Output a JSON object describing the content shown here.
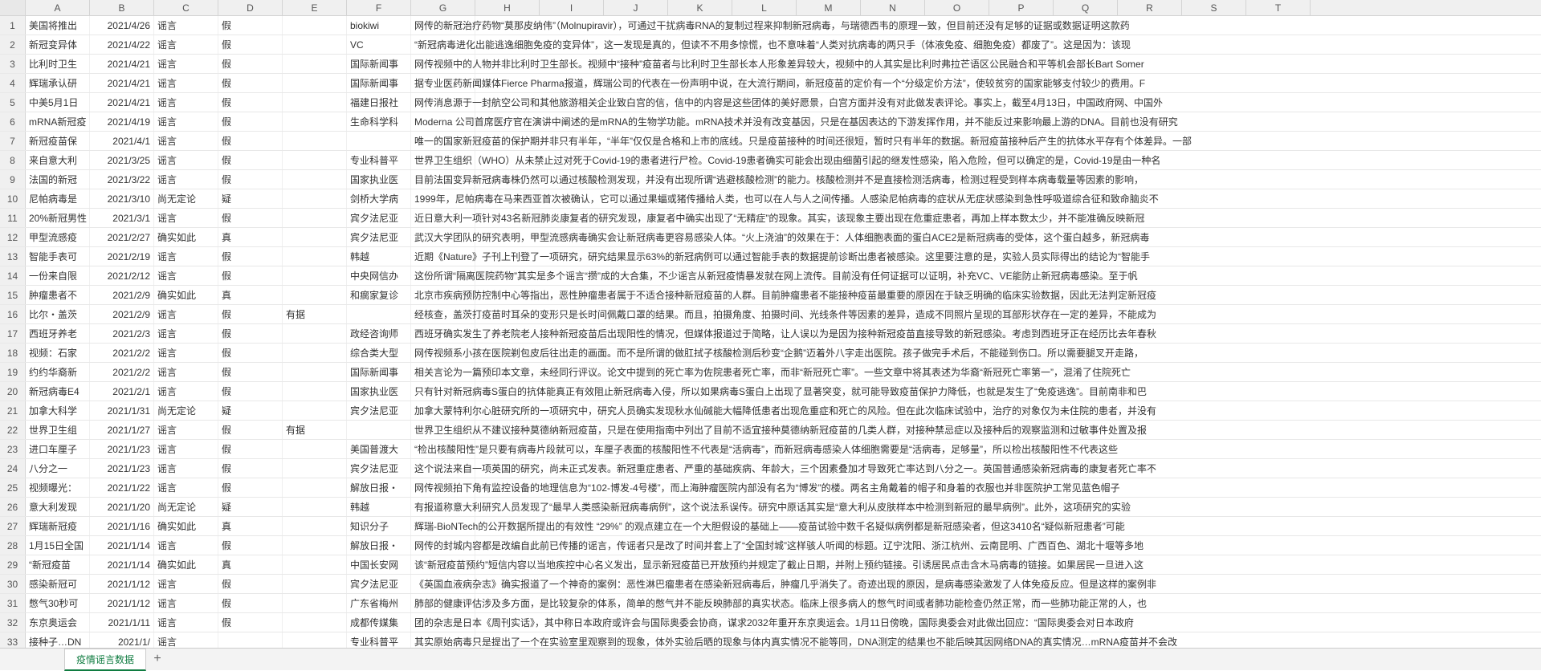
{
  "sheetTab": "疫情谣言数据",
  "colWidths": {
    "A": 80,
    "B": 80,
    "C": 80,
    "D": 80,
    "E": 80,
    "F": 80,
    "G": 80,
    "H": 80,
    "I": 80,
    "J": 80,
    "K": 80,
    "L": 80,
    "M": 80,
    "N": 80,
    "O": 80,
    "P": 80,
    "Q": 80,
    "R": 80,
    "S": 80,
    "T": 80
  },
  "columns": [
    "A",
    "B",
    "C",
    "D",
    "E",
    "F",
    "G",
    "H",
    "I",
    "J",
    "K",
    "L",
    "M",
    "N",
    "O",
    "P",
    "Q",
    "R",
    "S",
    "T"
  ],
  "rows": [
    {
      "n": 1,
      "A": "美国将推出",
      "B": "2021/4/26",
      "C": "谣言",
      "D": "假",
      "E": "",
      "F": "biokiwi",
      "G": "网传的新冠治疗药物“莫那皮纳伟”（Molnupiravir），可通过干扰病毒RNA的复制过程来抑制新冠病毒，与瑞德西韦的原理一致，但目前还没有足够的证据或数据证明这款药"
    },
    {
      "n": 2,
      "A": "新冠变异体",
      "B": "2021/4/22",
      "C": "谣言",
      "D": "假",
      "E": "",
      "F": "VC",
      "G": "“新冠病毒进化出能逃逸细胞免疫的变异体”，这一发现是真的，但读不不用多惊慌，也不意味着“人类对抗病毒的两只手（体液免疫、细胞免疫）都废了”。这是因为：该现"
    },
    {
      "n": 3,
      "A": "比利时卫生",
      "B": "2021/4/21",
      "C": "谣言",
      "D": "假",
      "E": "",
      "F": "国际新闻事",
      "G": "网传视频中的人物并非比利时卫生部长。视频中“接种”疫苗者与比利时卫生部长本人形象差异较大，视频中的人其实是比利时弗拉芒语区公民融合和平等机会部长Bart Somer"
    },
    {
      "n": 4,
      "A": "辉瑞承认研",
      "B": "2021/4/21",
      "C": "谣言",
      "D": "假",
      "E": "",
      "F": "国际新闻事",
      "G": "据专业医药新闻媒体Fierce Pharma报道，辉瑞公司的代表在一份声明中说，在大流行期间，新冠疫苗的定价有一个“分级定价方法”，使较贫穷的国家能够支付较少的费用。F"
    },
    {
      "n": 5,
      "A": "中美5月1日",
      "B": "2021/4/21",
      "C": "谣言",
      "D": "假",
      "E": "",
      "F": "福建日报社",
      "G": "网传消息源于一封航空公司和其他旅游相关企业致白宫的信，信中的内容是这些团体的美好愿景，白宫方面并没有对此做发表评论。事实上，截至4月13日，中国政府网、中国外"
    },
    {
      "n": 6,
      "A": "mRNA新冠疫",
      "B": "2021/4/19",
      "C": "谣言",
      "D": "假",
      "E": "",
      "F": "生命科学科",
      "G": "Moderna 公司首席医疗官在演讲中阐述的是mRNA的生物学功能。mRNA技术并没有改变基因，只是在基因表达的下游发挥作用，并不能反过来影响最上游的DNA。目前也没有研究"
    },
    {
      "n": 7,
      "A": "新冠疫苗保",
      "B": "2021/4/1",
      "C": "谣言",
      "D": "假",
      "E": "",
      "F": "",
      "G": "唯一的国家新冠疫苗的保护期并非只有半年，“半年”仅仅是合格和上市的底线。只是疫苗接种的时间还很短，暂时只有半年的数据。新冠疫苗接种后产生的抗体水平存有个体差异。一部"
    },
    {
      "n": 8,
      "A": "来自意大利",
      "B": "2021/3/25",
      "C": "谣言",
      "D": "假",
      "E": "",
      "F": "专业科普平",
      "G": "世界卫生组织（WHO）从未禁止过对死于Covid-19的患者进行尸检。Covid-19患者确实可能会出现由细菌引起的继发性感染，陷入危险，但可以确定的是，Covid-19是由一种名"
    },
    {
      "n": 9,
      "A": "法国的新冠",
      "B": "2021/3/22",
      "C": "谣言",
      "D": "假",
      "E": "",
      "F": "国家执业医",
      "G": "目前法国变异新冠病毒株仍然可以通过核酸检测发现，并没有出现所谓“逃避核酸检测”的能力。核酸检测并不是直接检测活病毒，检测过程受到样本病毒载量等因素的影响，"
    },
    {
      "n": 10,
      "A": "尼帕病毒是",
      "B": "2021/3/10",
      "C": "尚无定论",
      "D": "疑",
      "E": "",
      "F": "剑桥大学病",
      "G": "1999年，尼帕病毒在马来西亚首次被确认，它可以通过果蝠或猪传播给人类，也可以在人与人之间传播。人感染尼帕病毒的症状从无症状感染到急性呼吸道综合征和致命脑炎不"
    },
    {
      "n": 11,
      "A": "20%新冠男性",
      "B": "2021/3/1",
      "C": "谣言",
      "D": "假",
      "E": "",
      "F": "宾夕法尼亚",
      "G": "近日意大利一项针对43名新冠肺炎康复者的研究发现，康复者中确实出现了“无精症”的现象。其实，该现象主要出现在危重症患者，再加上样本数太少，并不能准确反映新冠"
    },
    {
      "n": 12,
      "A": "甲型流感疫",
      "B": "2021/2/27",
      "C": "确实如此",
      "D": "真",
      "E": "",
      "F": "宾夕法尼亚",
      "G": "武汉大学团队的研究表明，甲型流感病毒确实会让新冠病毒更容易感染人体。“火上浇油”的效果在于：人体细胞表面的蛋白ACE2是新冠病毒的受体，这个蛋白越多，新冠病毒"
    },
    {
      "n": 13,
      "A": "智能手表可",
      "B": "2021/2/19",
      "C": "谣言",
      "D": "假",
      "E": "",
      "F": "韩越",
      "G": "近期《Nature》子刊上刊登了一项研究，研究结果显示63%的新冠病例可以通过智能手表的数据提前诊断出患者被感染。这里要注意的是，实验人员实际得出的结论为“智能手"
    },
    {
      "n": 14,
      "A": "一份来自限",
      "B": "2021/2/12",
      "C": "谣言",
      "D": "假",
      "E": "",
      "F": "中央网信办",
      "G": "这份所谓“隔离医院药物”其实是多个谣言“攒”成的大合集，不少谣言从新冠疫情暴发就在网上流传。目前没有任何证据可以证明，补充VC、VE能防止新冠病毒感染。至于帆"
    },
    {
      "n": 15,
      "A": "肿瘤患者不",
      "B": "2021/2/9",
      "C": "确实如此",
      "D": "真",
      "E": "",
      "F": "和瘸家复诊",
      "G": "北京市疾病预防控制中心等指出，恶性肿瘤患者属于不适合接种新冠疫苗的人群。目前肿瘤患者不能接种疫苗最重要的原因在于缺乏明确的临床实验数据，因此无法判定新冠疫"
    },
    {
      "n": 16,
      "A": "比尔・盖茨",
      "B": "2021/2/9",
      "C": "谣言",
      "D": "假",
      "E": "有据",
      "F": "",
      "G": "经核查，盖茨打疫苗时耳朵的变形只是长时间佩戴口罩的结果。而且，拍摄角度、拍摄时间、光线条件等因素的差异，造成不同照片呈现的耳部形状存在一定的差异，不能成为"
    },
    {
      "n": 17,
      "A": "西班牙养老",
      "B": "2021/2/3",
      "C": "谣言",
      "D": "假",
      "E": "",
      "F": "政经咨询师",
      "G": "西班牙确实发生了养老院老人接种新冠疫苗后出现阳性的情况，但媒体报道过于简略，让人误以为是因为接种新冠疫苗直接导致的新冠感染。考虑到西班牙正在经历比去年春秋"
    },
    {
      "n": 18,
      "A": "视频：石家",
      "B": "2021/2/2",
      "C": "谣言",
      "D": "假",
      "E": "",
      "F": "综合类大型",
      "G": "网传视频系小孩在医院剃包皮后往出走的画面。而不是所谓的做肛拭子核酸检测后秒变“企鹅”迈着外八字走出医院。孩子做完手术后，不能碰到伤口。所以需要腿叉开走路，"
    },
    {
      "n": 19,
      "A": "约约华裔新",
      "B": "2021/2/2",
      "C": "谣言",
      "D": "假",
      "E": "",
      "F": "国际新闻事",
      "G": "相关言论为一篇预印本文章，未经同行评议。论文中提到的死亡率为佐院患者死亡率，而非“新冠死亡率”。一些文章中将其表述为华裔“新冠死亡率第一”，混淆了住院死亡"
    },
    {
      "n": 20,
      "A": "新冠病毒E4",
      "B": "2021/2/1",
      "C": "谣言",
      "D": "假",
      "E": "",
      "F": "国家执业医",
      "G": "只有针对新冠病毒S蛋白的抗体能真正有效阻止新冠病毒入侵，所以如果病毒S蛋白上出现了显著突变，就可能导致疫苗保护力降低，也就是发生了“免疫逃逸”。目前南非和巴"
    },
    {
      "n": 21,
      "A": "加拿大科学",
      "B": "2021/1/31",
      "C": "尚无定论",
      "D": "疑",
      "E": "",
      "F": "宾夕法尼亚",
      "G": "加拿大蒙特利尔心脏研究所的一项研究中，研究人员确实发现秋水仙碱能大幅降低患者出现危重症和死亡的风险。但在此次临床试验中，治疗的对象仅为未住院的患者，并没有"
    },
    {
      "n": 22,
      "A": "世界卫生组",
      "B": "2021/1/27",
      "C": "谣言",
      "D": "假",
      "E": "有据",
      "F": "",
      "G": "世界卫生组织从不建议接种莫德纳新冠疫苗，只是在使用指南中列出了目前不适宜接种莫德纳新冠疫苗的几类人群，对接种禁忌症以及接种后的观察监测和过敏事件处置及报"
    },
    {
      "n": 23,
      "A": "进口车厘子",
      "B": "2021/1/23",
      "C": "谣言",
      "D": "假",
      "E": "",
      "F": "美国普渡大",
      "G": "“检出核酸阳性”是只要有病毒片段就可以，车厘子表面的核酸阳性不代表是“活病毒”，而新冠病毒感染人体细胞需要是“活病毒，足够量”，所以检出核酸阳性不代表这些"
    },
    {
      "n": 24,
      "A": "八分之一",
      "B": "2021/1/23",
      "C": "谣言",
      "D": "假",
      "E": "",
      "F": "宾夕法尼亚",
      "G": "这个说法来自一项英国的研究，尚未正式发表。新冠重症患者、严重的基础疾病、年龄大，三个因素叠加才导致死亡率达到八分之一。英国普通感染新冠病毒的康复者死亡率不"
    },
    {
      "n": 25,
      "A": "视频曝光：",
      "B": "2021/1/22",
      "C": "谣言",
      "D": "假",
      "E": "",
      "F": "解放日报・",
      "G": "网传视频拍下角有监控设备的地理信息为“102-博发-4号楼”，而上海肿瘤医院内部没有名为“博发”的楼。两名主角戴着的帽子和身着的衣服也并非医院护工常见蓝色帽子"
    },
    {
      "n": 26,
      "A": "意大利发现",
      "B": "2021/1/20",
      "C": "尚无定论",
      "D": "疑",
      "E": "",
      "F": "韩越",
      "G": "有报道称意大利研究人员发现了“最早人类感染新冠病毒病例”，这个说法系误传。研究中原话其实是“意大利从皮肤样本中检测到新冠的最早病例”。此外，这项研究的实验"
    },
    {
      "n": 27,
      "A": "辉瑞新冠疫",
      "B": "2021/1/16",
      "C": "确实如此",
      "D": "真",
      "E": "",
      "F": "知识分子",
      "G": "辉瑞-BioNTech的公开数据所提出的有效性  “29%”  的观点建立在一个大胆假设的基础上——疫苗试验中数千名疑似病例都是新冠感染者，但这3410名“疑似新冠患者”可能"
    },
    {
      "n": 28,
      "A": "1月15日全国",
      "B": "2021/1/14",
      "C": "谣言",
      "D": "假",
      "E": "",
      "F": "解放日报・",
      "G": "网传的封城内容都是改编自此前已传播的谣言，传谣者只是改了时间并套上了“全国封城”这样骇人听闻的标题。辽宁沈阳、浙江杭州、云南昆明、广西百色、湖北十堰等多地"
    },
    {
      "n": 29,
      "A": "“新冠疫苗",
      "B": "2021/1/14",
      "C": "确实如此",
      "D": "真",
      "E": "",
      "F": "中国长安网",
      "G": "该“新冠疫苗预约”短信内容以当地疾控中心名义发出，显示新冠疫苗已开放预约并规定了截止日期，并附上预约链接。引诱居民点击含木马病毒的链接。如果居民一旦进入这"
    },
    {
      "n": 30,
      "A": "感染新冠可",
      "B": "2021/1/12",
      "C": "谣言",
      "D": "假",
      "E": "",
      "F": "宾夕法尼亚",
      "G": "《英国血液病杂志》确实报道了一个神奇的案例：恶性淋巴瘤患者在感染新冠病毒后，肿瘤几乎消失了。奇迹出现的原因，是病毒感染激发了人体免疫反应。但是这样的案例非"
    },
    {
      "n": 31,
      "A": "憋气30秒可",
      "B": "2021/1/12",
      "C": "谣言",
      "D": "假",
      "E": "",
      "F": "广东省梅州",
      "G": "肺部的健康评估涉及多方面，是比较复杂的体系，简单的憋气并不能反映肺部的真实状态。临床上很多病人的憋气时间或者肺功能检查仍然正常，而一些肺功能正常的人，也"
    },
    {
      "n": 32,
      "A": "东京奥运会",
      "B": "2021/1/11",
      "C": "谣言",
      "D": "假",
      "E": "",
      "F": "成都传媒集",
      "G": "团的杂志是日本《周刊实话》，其中称日本政府或许会与国际奥委会协商，谋求2032年重开东京奥运会。1月11日傍晚，国际奥委会对此做出回应：“国际奥委会对日本政府"
    },
    {
      "n": 33,
      "A": "接种子…DN",
      "B": "2021/1/",
      "C": "谣言",
      "D": "",
      "E": "",
      "F": "专业科普平",
      "G": "其实原始病毒只是提出了一个在实验室里观察到的现象，体外实验后晒的现象与体内真实情况不能等同，DNA测定的结果也不能后映其因网络DNA的真实情况…mRNA疫苗并不会改"
    }
  ]
}
